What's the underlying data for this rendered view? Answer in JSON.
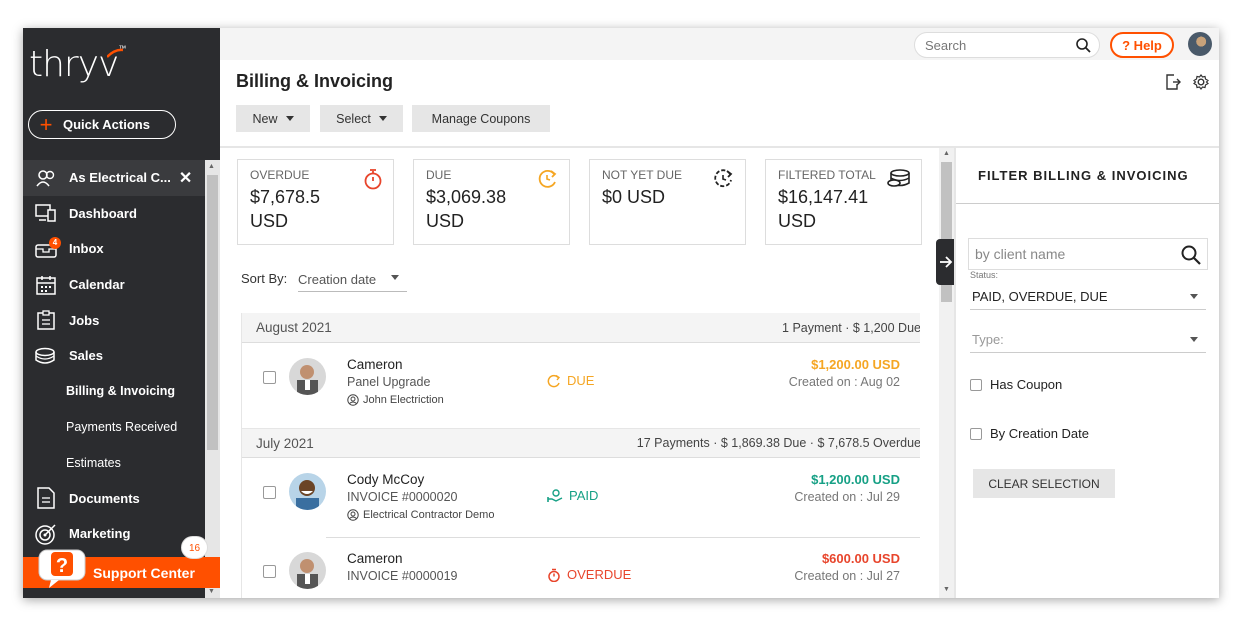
{
  "brand": {
    "logo": "thryv",
    "accent": "#ff5000",
    "sidebar_bg": "#2b2c2f"
  },
  "sidebar": {
    "quick_actions": "Quick Actions",
    "company": "As Electrical C...",
    "items": [
      {
        "label": "Dashboard",
        "icon": "dashboard-icon"
      },
      {
        "label": "Inbox",
        "icon": "inbox-icon",
        "badge": "4"
      },
      {
        "label": "Calendar",
        "icon": "calendar-icon"
      },
      {
        "label": "Jobs",
        "icon": "jobs-icon"
      },
      {
        "label": "Sales",
        "icon": "sales-icon"
      }
    ],
    "sub_items": [
      "Billing & Invoicing",
      "Payments Received",
      "Estimates"
    ],
    "items2": [
      {
        "label": "Documents",
        "icon": "documents-icon"
      },
      {
        "label": "Marketing",
        "icon": "marketing-icon"
      }
    ],
    "support": "Support Center",
    "support_badge": "16"
  },
  "topbar": {
    "search_placeholder": "Search",
    "help": "? Help"
  },
  "page": {
    "title": "Billing & Invoicing",
    "buttons": {
      "new": "New",
      "select": "Select",
      "coupons": "Manage Coupons"
    }
  },
  "stats": [
    {
      "title": "OVERDUE",
      "value": "$7,678.5 USD",
      "icon": "stopwatch-icon",
      "color": "#e8452c"
    },
    {
      "title": "DUE",
      "value": "$3,069.38 USD",
      "icon": "clock-arrow-icon",
      "color": "#f5a623"
    },
    {
      "title": "NOT YET DUE",
      "value": "$0 USD",
      "icon": "clock-dashed-icon",
      "color": "#222222"
    },
    {
      "title": "FILTERED TOTAL",
      "value": "$16,147.41 USD",
      "icon": "coins-icon",
      "color": "#222222"
    }
  ],
  "sort": {
    "label": "Sort By:",
    "value": "Creation date"
  },
  "groups": [
    {
      "month": "August 2021",
      "summary": "1 Payment  · $ 1,200 Due",
      "rows": [
        {
          "name": "Cameron",
          "desc": "Panel Upgrade",
          "contact": "John Electriction",
          "status": "DUE",
          "amount": "$1,200.00 USD",
          "date": "Created on : Aug 02"
        }
      ]
    },
    {
      "month": "July 2021",
      "summary": "17 Payments  · $ 1,869.38 Due  · $ 7,678.5 Overdue",
      "rows": [
        {
          "name": "Cody McCoy",
          "desc": "INVOICE #0000020",
          "contact": "Electrical Contractor Demo",
          "status": "PAID",
          "amount": "$1,200.00 USD",
          "date": "Created on : Jul 29"
        },
        {
          "name": "Cameron",
          "desc": "INVOICE #0000019",
          "contact": "",
          "status": "OVERDUE",
          "amount": "$600.00 USD",
          "date": "Created on : Jul 27"
        }
      ]
    }
  ],
  "status_colors": {
    "due": "#f5a623",
    "paid": "#16a085",
    "overdue": "#e8452c"
  },
  "filter": {
    "title": "FILTER BILLING & INVOICING",
    "search_placeholder": "by client name",
    "status_label": "Status:",
    "status_value": "PAID, OVERDUE, DUE",
    "type_placeholder": "Type:",
    "has_coupon": "Has Coupon",
    "by_creation_date": "By Creation Date",
    "clear": "CLEAR SELECTION"
  }
}
